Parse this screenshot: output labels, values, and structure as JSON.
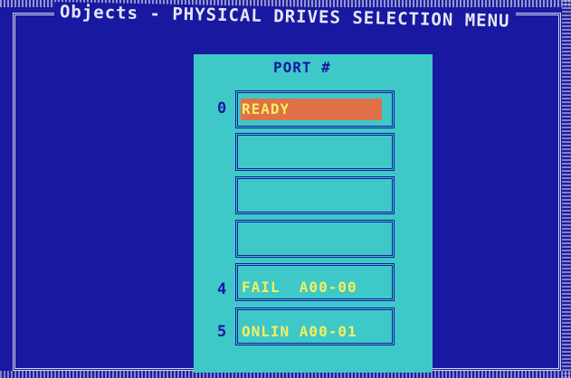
{
  "window": {
    "title": "Objects - PHYSICAL DRIVES SELECTION MENU"
  },
  "panel": {
    "header": "PORT #"
  },
  "ports": [
    {
      "number": "0",
      "status": "READY",
      "selected": true
    },
    {
      "number": "",
      "status": "",
      "selected": false
    },
    {
      "number": "",
      "status": "",
      "selected": false
    },
    {
      "number": "",
      "status": "",
      "selected": false
    },
    {
      "number": "4",
      "status": "FAIL  A00-00",
      "selected": false
    },
    {
      "number": "5",
      "status": "ONLIN A00-01",
      "selected": false
    }
  ],
  "colors": {
    "background": "#1818a0",
    "panel": "#3ec8c8",
    "highlight": "#e07048",
    "text_yellow": "#f0f060",
    "text_blue": "#1818a0",
    "frame": "#d8d8f0"
  }
}
